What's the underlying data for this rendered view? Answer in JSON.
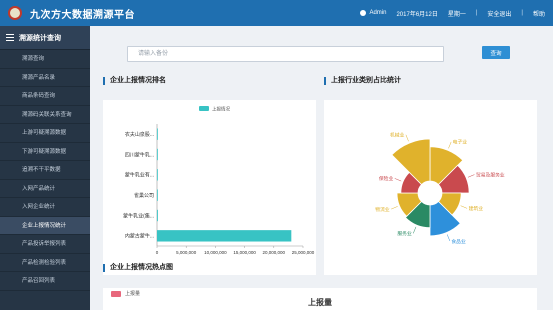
{
  "header": {
    "app_title": "九次方大数据溯源平台",
    "user": "Admin",
    "date": "2017年6月12日",
    "weekday": "星期一",
    "logout": "安全退出",
    "help": "帮助"
  },
  "sidebar": {
    "title": "溯源统计查询",
    "items": [
      {
        "label": "溯源查询"
      },
      {
        "label": "溯源产品名录"
      },
      {
        "label": "商品条码查询"
      },
      {
        "label": "溯源码关联关系查询"
      },
      {
        "label": "上游可疑溯源数据"
      },
      {
        "label": "下游可疑溯源数据"
      },
      {
        "label": "追溯不干平数据"
      },
      {
        "label": "入网产品统计"
      },
      {
        "label": "入网企业统计"
      },
      {
        "label": "企业上报情况统计"
      },
      {
        "label": "产品投诉举报列表"
      },
      {
        "label": "产品检测检验列表"
      },
      {
        "label": "产品召回列表"
      }
    ]
  },
  "search": {
    "placeholder": "请输入备份",
    "button": "查询"
  },
  "panels": {
    "ranking_title": "企业上报情况排名",
    "category_title": "上报行业类别占比统计",
    "heatmap_title": "企业上报情况热点图",
    "heatmap_legend": "上报量",
    "heatmap_chart_title": "上报量"
  },
  "colors": {
    "header_blue": "#1f6fb0",
    "bar_teal": "#38c3c4",
    "sidebar_bg": "#263545",
    "heat_legend": "#e8677c"
  },
  "chart_data": [
    {
      "type": "bar",
      "orientation": "horizontal",
      "legend": [
        "上报情况"
      ],
      "categories": [
        "农夫山泉股...",
        "四川蒙牛乳...",
        "蒙牛乳业有...",
        "雀巢公司",
        "蒙牛乳业(集...",
        "内蒙古蒙牛..."
      ],
      "series": [
        {
          "name": "上报情况",
          "values": [
            40000,
            20000,
            15000,
            30000,
            150000,
            23000000
          ]
        }
      ],
      "xticks": [
        "0",
        "5,000,000",
        "10,000,000",
        "15,000,000",
        "20,000,000",
        "25,000,000"
      ],
      "xlim": [
        0,
        25000000
      ]
    },
    {
      "type": "pie",
      "variant": "nightingale-rose",
      "slices": [
        {
          "name": "电子业",
          "value": 32,
          "color": "#e0b22c"
        },
        {
          "name": "贸易及服务业",
          "value": 20,
          "color": "#c94a4e"
        },
        {
          "name": "建筑业",
          "value": 10,
          "color": "#e0b22c"
        },
        {
          "name": "食品业",
          "value": 26,
          "color": "#2e90db"
        },
        {
          "name": "服务业",
          "value": 14,
          "color": "#2a8a64"
        },
        {
          "name": "物流业",
          "value": 12,
          "color": "#e0b22c"
        },
        {
          "name": "保险业",
          "value": 8,
          "color": "#c94a4e"
        },
        {
          "name": "机械业",
          "value": 48,
          "color": "#e0b22c"
        }
      ]
    }
  ]
}
